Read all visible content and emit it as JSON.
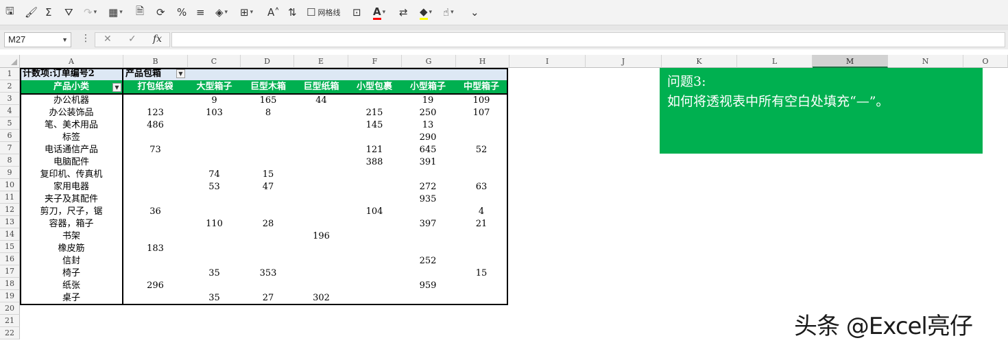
{
  "toolbar": {
    "items": [
      {
        "name": "save-icon",
        "glyph": "🖫"
      },
      {
        "name": "format-painter-icon",
        "glyph": "🖌"
      },
      {
        "name": "autosum-icon",
        "glyph": "Σ"
      },
      {
        "name": "filter-icon",
        "glyph": "⛛"
      },
      {
        "name": "redo-icon",
        "glyph": "↷"
      },
      {
        "name": "table-icon",
        "glyph": "▦"
      },
      {
        "name": "document-icon",
        "glyph": "🗎"
      },
      {
        "name": "refresh-icon",
        "glyph": "⟳"
      },
      {
        "name": "percent-icon",
        "glyph": "%"
      },
      {
        "name": "align-icon",
        "glyph": "≡"
      },
      {
        "name": "eraser-icon",
        "glyph": "◈"
      },
      {
        "name": "insert-icon",
        "glyph": "⊞"
      },
      {
        "name": "font-size-icon",
        "glyph": "A˄"
      },
      {
        "name": "sort-icon",
        "glyph": "⇅"
      },
      {
        "name": "gridlines-checkbox-icon",
        "glyph": "☐"
      },
      {
        "name": "borders-icon",
        "glyph": "⊡"
      },
      {
        "name": "font-color-icon",
        "glyph": "A"
      },
      {
        "name": "wrap-icon",
        "glyph": "⇄"
      },
      {
        "name": "fill-color-icon",
        "glyph": "◆"
      },
      {
        "name": "touch-icon",
        "glyph": "☝"
      },
      {
        "name": "more-icon",
        "glyph": "⌄"
      }
    ],
    "gridlines_label": "网格线",
    "font_color": "#ff0000",
    "fill_color": "#ffff00"
  },
  "formula_bar": {
    "cell_ref": "M27",
    "cancel": "✕",
    "confirm": "✓",
    "fx": "fx",
    "formula": ""
  },
  "columns": [
    "A",
    "B",
    "C",
    "D",
    "E",
    "F",
    "G",
    "H",
    "I",
    "J",
    "K",
    "L",
    "M",
    "N",
    "O"
  ],
  "selected_column": "M",
  "rows": [
    "1",
    "2",
    "3",
    "4",
    "5",
    "6",
    "7",
    "8",
    "9",
    "10",
    "11",
    "12",
    "13",
    "14",
    "15",
    "16",
    "17",
    "18",
    "19",
    "20",
    "21",
    "22"
  ],
  "pivot": {
    "count_label": "计数项:订单编号2",
    "col_field": "产品包箱",
    "row_field": "产品小类",
    "headers": [
      "打包纸袋",
      "大型箱子",
      "巨型木箱",
      "巨型纸箱",
      "小型包裹",
      "小型箱子",
      "中型箱子"
    ],
    "rows": [
      {
        "label": "办公机器",
        "values": [
          "",
          "9",
          "165",
          "44",
          "",
          "19",
          "109"
        ]
      },
      {
        "label": "办公装饰品",
        "values": [
          "123",
          "103",
          "8",
          "",
          "215",
          "250",
          "107"
        ]
      },
      {
        "label": "笔、美术用品",
        "values": [
          "486",
          "",
          "",
          "",
          "145",
          "13",
          ""
        ]
      },
      {
        "label": "标签",
        "values": [
          "",
          "",
          "",
          "",
          "",
          "290",
          ""
        ]
      },
      {
        "label": "电话通信产品",
        "values": [
          "73",
          "",
          "",
          "",
          "121",
          "645",
          "52"
        ]
      },
      {
        "label": "电脑配件",
        "values": [
          "",
          "",
          "",
          "",
          "388",
          "391",
          ""
        ]
      },
      {
        "label": "复印机、传真机",
        "values": [
          "",
          "74",
          "15",
          "",
          "",
          "",
          ""
        ]
      },
      {
        "label": "家用电器",
        "values": [
          "",
          "53",
          "47",
          "",
          "",
          "272",
          "63"
        ]
      },
      {
        "label": "夹子及其配件",
        "values": [
          "",
          "",
          "",
          "",
          "",
          "935",
          ""
        ]
      },
      {
        "label": "剪刀，尺子，锯",
        "values": [
          "36",
          "",
          "",
          "",
          "104",
          "",
          "4"
        ]
      },
      {
        "label": "容器，箱子",
        "values": [
          "",
          "110",
          "28",
          "",
          "",
          "397",
          "21"
        ]
      },
      {
        "label": "书架",
        "values": [
          "",
          "",
          "",
          "196",
          "",
          "",
          ""
        ]
      },
      {
        "label": "橡皮筋",
        "values": [
          "183",
          "",
          "",
          "",
          "",
          "",
          ""
        ]
      },
      {
        "label": "信封",
        "values": [
          "",
          "",
          "",
          "",
          "",
          "252",
          ""
        ]
      },
      {
        "label": "椅子",
        "values": [
          "",
          "35",
          "353",
          "",
          "",
          "",
          "15"
        ]
      },
      {
        "label": "纸张",
        "values": [
          "296",
          "",
          "",
          "",
          "",
          "959",
          ""
        ]
      },
      {
        "label": "桌子",
        "values": [
          "",
          "35",
          "27",
          "302",
          "",
          "",
          ""
        ]
      }
    ]
  },
  "note": {
    "line1": "问题3:",
    "line2": "如何将透视表中所有空白处填充“—”。",
    "color": "#00b050"
  },
  "watermark": "头条 @Excel亮仔"
}
